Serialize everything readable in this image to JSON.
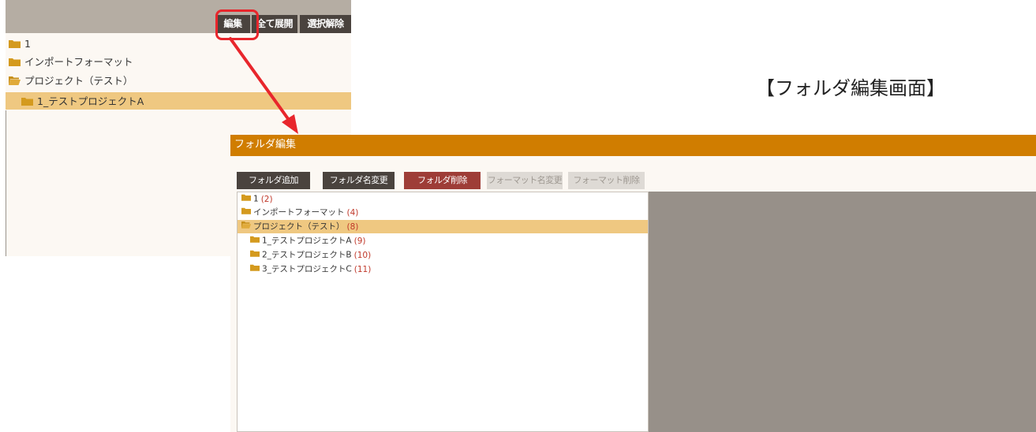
{
  "caption": "【フォルダ編集画面】",
  "colors": {
    "accent": "#d07d00",
    "highlight": "#efc881",
    "annotation_red": "#e8262c",
    "folder_icon": "#d49a1e",
    "count_text": "#c0392b"
  },
  "tree_panel": {
    "toolbar": {
      "edit_label": "編集",
      "expand_all_label": "全て展開",
      "deselect_label": "選択解除"
    },
    "items": [
      {
        "label": "1",
        "icon": "folder-closed-icon"
      },
      {
        "label": "インポートフォーマット",
        "icon": "folder-closed-icon"
      },
      {
        "label": "プロジェクト（テスト）",
        "icon": "folder-open-icon"
      },
      {
        "label": "1_テストプロジェクトA",
        "icon": "folder-closed-icon",
        "selected": true
      }
    ]
  },
  "edit_window": {
    "title": "フォルダ編集",
    "buttons": {
      "add_folder": "フォルダ追加",
      "rename_folder": "フォルダ名変更",
      "delete_folder": "フォルダ削除",
      "rename_format": "フォーマット名変更",
      "delete_format": "フォーマット削除"
    },
    "items": [
      {
        "label": "1",
        "count": "(2)",
        "icon": "folder-closed-icon"
      },
      {
        "label": "インポートフォーマット",
        "count": "(4)",
        "icon": "folder-closed-icon"
      },
      {
        "label": "プロジェクト（テスト）",
        "count": "(8)",
        "icon": "folder-open-icon",
        "selected": true
      },
      {
        "label": "1_テストプロジェクトA",
        "count": "(9)",
        "icon": "folder-closed-icon"
      },
      {
        "label": "2_テストプロジェクトB",
        "count": "(10)",
        "icon": "folder-closed-icon"
      },
      {
        "label": "3_テストプロジェクトC",
        "count": "(11)",
        "icon": "folder-closed-icon"
      }
    ]
  }
}
